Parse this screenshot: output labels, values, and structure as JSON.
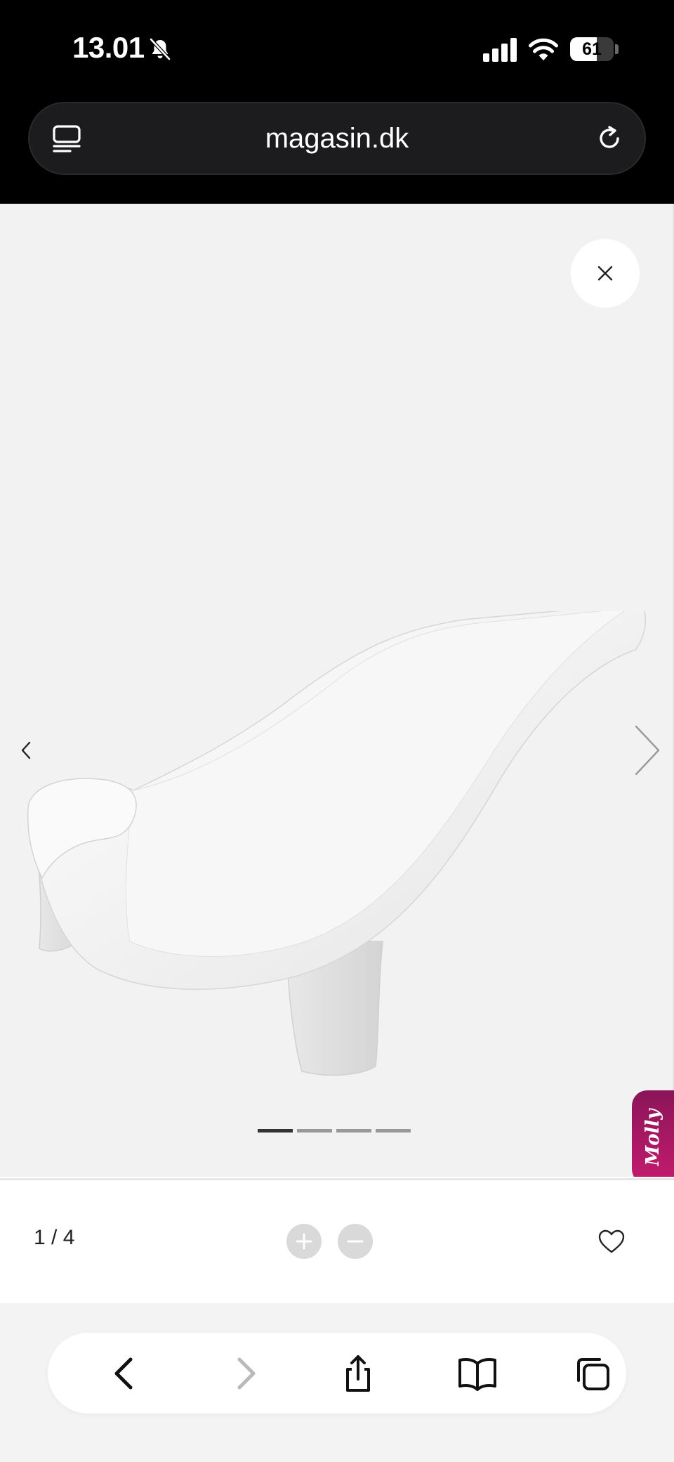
{
  "status_bar": {
    "time": "13.01",
    "battery": "61",
    "battery_level": 0.61
  },
  "url_bar": {
    "domain": "magasin.dk"
  },
  "gallery": {
    "image_alt": "White baby bath seat",
    "total_slides": 4,
    "active_slide": 1,
    "counter": "1 / 4"
  },
  "chat_widget": {
    "label": "Molly"
  },
  "colors": {
    "chrome": "#000000",
    "url_pill": "#1c1c1e",
    "gallery_bg": "#f2f2f2",
    "molly_accent": "#c51b6e"
  },
  "icons": {
    "status": [
      "bell-slash-icon",
      "signal-icon",
      "wifi-icon",
      "battery-icon"
    ],
    "url_bar": [
      "tabs-format-icon",
      "reload-icon"
    ],
    "gallery": [
      "close-icon",
      "chevron-left-icon",
      "chevron-right-icon"
    ],
    "info": [
      "zoom-in-icon",
      "zoom-out-icon",
      "heart-icon"
    ],
    "toolbar": [
      "back-icon",
      "forward-icon",
      "share-icon",
      "bookmarks-icon",
      "tabs-icon"
    ]
  }
}
